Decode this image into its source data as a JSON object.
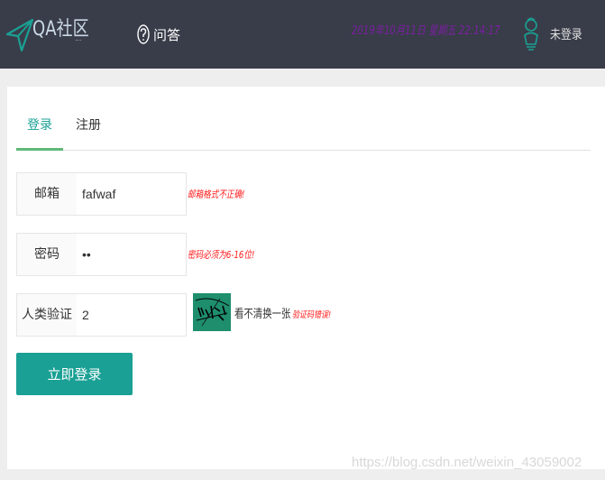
{
  "header": {
    "logo_text": "QA社区",
    "nav_qa": "问答",
    "datetime": "2019年10月11日 星期五 22:14:17",
    "user_status": "未登录"
  },
  "tabs": [
    {
      "label": "登录",
      "active": true
    },
    {
      "label": "注册",
      "active": false
    }
  ],
  "form": {
    "email": {
      "label": "邮箱",
      "value": "fafwaf",
      "error": "邮箱格式不正确!"
    },
    "password": {
      "label": "密码",
      "value": "••",
      "error": "密码必须为6-16位!"
    },
    "captcha": {
      "label": "人类验证",
      "value": "2",
      "hint": "看不清换一张",
      "error": "验证码错误!"
    },
    "submit_label": "立即登录"
  },
  "watermark": "https://blog.csdn.net/weixin_43059002",
  "colors": {
    "topbar": "#393d49",
    "accent": "#1aa094",
    "tab_underline": "#5fb878",
    "error": "#ff1a1a",
    "datetime": "#7b1fa2"
  }
}
